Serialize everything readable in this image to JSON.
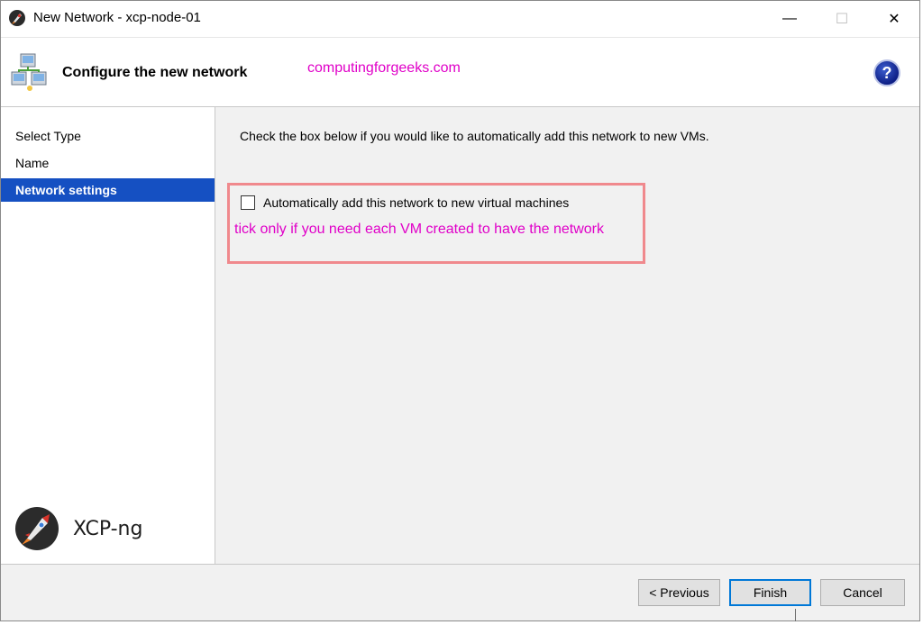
{
  "window": {
    "title": "New Network - xcp-node-01",
    "minimize_glyph": "—",
    "maximize_glyph": "☐",
    "close_glyph": "✕"
  },
  "header": {
    "title": "Configure the new network",
    "watermark": "computingforgeeks.com",
    "help_label": "?",
    "icon": "network-wizard-icon"
  },
  "sidebar": {
    "items": [
      {
        "label": "Select Type",
        "active": false
      },
      {
        "label": "Name",
        "active": false
      },
      {
        "label": "Network settings",
        "active": true
      }
    ],
    "brand": "XCP-ng"
  },
  "content": {
    "instruction": "Check the box below if you would like to automatically add this network to new VMs.",
    "checkbox_label": "Automatically add this network to new virtual machines",
    "checkbox_checked": false,
    "annotation": "tick only if you need each VM created to have the network"
  },
  "footer": {
    "previous_label": "< Previous",
    "finish_label": "Finish",
    "cancel_label": "Cancel"
  },
  "colors": {
    "nav_active_bg": "#1550c2",
    "annotation": "#e000c8",
    "highlight_border": "#f0898d",
    "default_button_border": "#0078d7"
  }
}
